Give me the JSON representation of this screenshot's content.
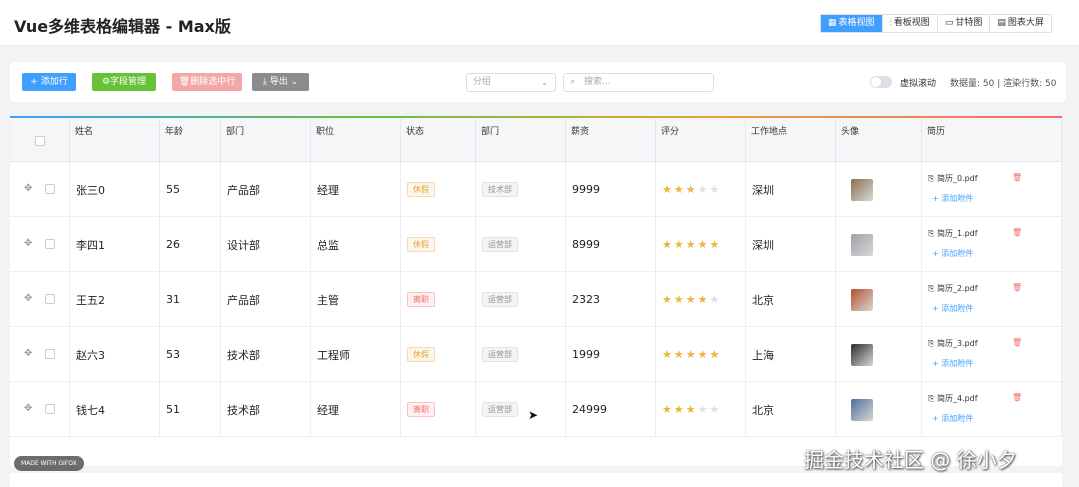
{
  "app": {
    "title": "Vue多维表格编辑器 - Max版"
  },
  "views": [
    {
      "icon": "grid-icon",
      "glyph": "▦",
      "label": "表格视图",
      "active": true
    },
    {
      "icon": "kanban-icon",
      "glyph": "⫶",
      "label": "看板视图",
      "active": false
    },
    {
      "icon": "gantt-icon",
      "glyph": "▭",
      "label": "甘特图",
      "active": false
    },
    {
      "icon": "dashboard-icon",
      "glyph": "▤",
      "label": "图表大屏",
      "active": false
    }
  ],
  "toolbar": {
    "add_row": "+ 添加行",
    "field_manage": "⚙字段管理",
    "delete_selected": "🗑删除选中行",
    "export": "⤓ 导出 ⌄",
    "group_placeholder": "分组",
    "search_placeholder": "搜索...",
    "virtual_scroll": "虚拟滚动",
    "stats": "数据量: 50 | 渲染行数: 50"
  },
  "columns": [
    "姓名",
    "年龄",
    "部门",
    "职位",
    "状态",
    "部门",
    "薪资",
    "评分",
    "工作地点",
    "头像",
    "简历"
  ],
  "rows": [
    {
      "name": "张三0",
      "age": "55",
      "dept": "产品部",
      "position": "经理",
      "status": "休假",
      "status_type": "orange",
      "dept2": "技术部",
      "salary": "9999",
      "rating": 3,
      "location": "深圳",
      "avatar_color": "#8b6f4e",
      "file": "简历_0.pdf",
      "add": "+ 添加附件"
    },
    {
      "name": "李四1",
      "age": "26",
      "dept": "设计部",
      "position": "总监",
      "status": "休假",
      "status_type": "orange",
      "dept2": "运营部",
      "salary": "8999",
      "rating": 5,
      "location": "深圳",
      "avatar_color": "#a0a0a8",
      "file": "简历_1.pdf",
      "add": "+ 添加附件"
    },
    {
      "name": "王五2",
      "age": "31",
      "dept": "产品部",
      "position": "主管",
      "status": "离职",
      "status_type": "red",
      "dept2": "运营部",
      "salary": "2323",
      "rating": 4,
      "location": "北京",
      "avatar_color": "#b5502a",
      "file": "简历_2.pdf",
      "add": "+ 添加附件"
    },
    {
      "name": "赵六3",
      "age": "53",
      "dept": "技术部",
      "position": "工程师",
      "status": "休假",
      "status_type": "orange",
      "dept2": "运营部",
      "salary": "1999",
      "rating": 5,
      "location": "上海",
      "avatar_color": "#2d2d2d",
      "file": "简历_3.pdf",
      "add": "+ 添加附件"
    },
    {
      "name": "钱七4",
      "age": "51",
      "dept": "技术部",
      "position": "经理",
      "status": "离职",
      "status_type": "red",
      "dept2": "运营部",
      "salary": "24999",
      "rating": 3,
      "location": "北京",
      "avatar_color": "#4f6f9a",
      "file": "简历_4.pdf",
      "add": "+ 添加附件"
    }
  ],
  "overlay": {
    "gifox": "MADE WITH GIFOX",
    "watermark": "掘金技术社区 @ 徐小夕"
  }
}
